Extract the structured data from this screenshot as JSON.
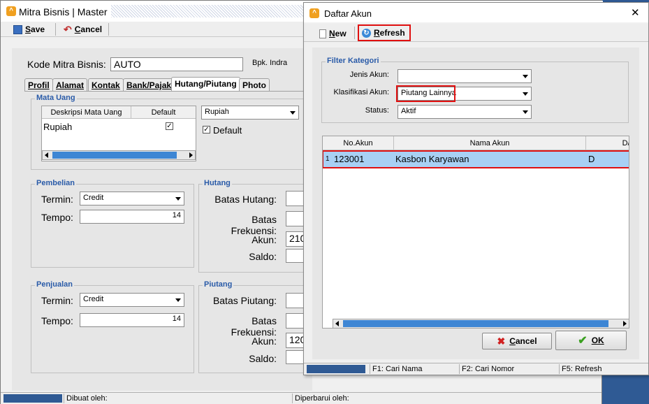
{
  "main": {
    "title": "Mitra Bisnis | Master",
    "toolbar": {
      "save": "ave",
      "save_u": "S",
      "cancel": "ancel",
      "cancel_u": "C"
    },
    "kode_label": "Kode Mitra Bisnis:",
    "kode_value": "AUTO",
    "owner": "Bpk. Indra",
    "tabs": [
      "Profil",
      "Alamat",
      "Kontak",
      "Bank/Pajak",
      "Hutang/Piutang",
      "Photo"
    ],
    "mata_uang": {
      "title": "Mata Uang",
      "col_desc": "Deskripsi Mata Uang",
      "col_default": "Default",
      "row_desc": "Rupiah",
      "row_default_checked": "✓",
      "combo": "Rupiah",
      "default_label": "Default",
      "default_check": "✓"
    },
    "pembelian": {
      "title": "Pembelian",
      "termin_label": "Termin:",
      "termin": "Credit",
      "tempo_label": "Tempo:",
      "tempo": "14"
    },
    "hutang": {
      "title": "Hutang",
      "batas_label": "Batas Hutang:",
      "frek_label": "Batas Frekuensi:",
      "akun_label": "Akun:",
      "akun": "210",
      "saldo_label": "Saldo:"
    },
    "penjualan": {
      "title": "Penjualan",
      "termin_label": "Termin:",
      "termin": "Credit",
      "tempo_label": "Tempo:",
      "tempo": "14"
    },
    "piutang": {
      "title": "Piutang",
      "batas_label": "Batas Piutang:",
      "frek_label": "Batas Frekuensi:",
      "akun_label": "Akun:",
      "akun": "120",
      "saldo_label": "Saldo:"
    },
    "status": {
      "dibuat": "Dibuat oleh:",
      "diperbarui": "Diperbarui oleh:"
    }
  },
  "dialog": {
    "title": "Daftar Akun",
    "close": "✕",
    "new_label": "ew",
    "new_u": "N",
    "refresh_label": "efresh",
    "refresh_u": "R",
    "filter_title": "Filter Kategori",
    "jenis_label": "Jenis Akun:",
    "jenis_value": "",
    "klas_label": "Klasifikasi Akun:",
    "klas_value": "Piutang Lainnya",
    "status_label": "Status:",
    "status_value": "Aktif",
    "grid": {
      "col_no": "No.Akun",
      "col_nama": "Nama Akun",
      "col_dk": "D/K",
      "rows": [
        {
          "idx": "1",
          "no": "123001",
          "nama": "Kasbon Karyawan",
          "dk": "D"
        }
      ]
    },
    "cancel_label": "ancel",
    "cancel_u": "C",
    "ok_label": "OK",
    "ok_u": "O",
    "status": {
      "f1": "F1: Cari Nama",
      "f2": "F2: Cari Nomor",
      "f5": "F5: Refresh"
    }
  },
  "colors": {
    "accent": "#2a5ba8",
    "highlight": "#a8d0f4",
    "danger": "#e01010",
    "desktop": "#2f5a94"
  }
}
